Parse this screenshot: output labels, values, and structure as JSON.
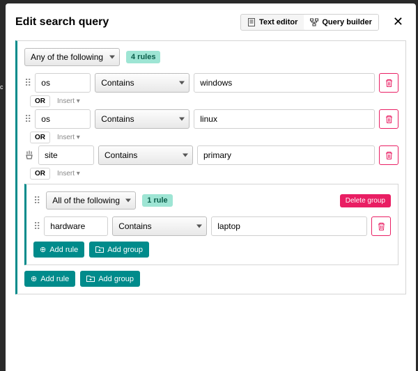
{
  "header": {
    "title": "Edit search query",
    "text_editor": "Text editor",
    "query_builder": "Query builder"
  },
  "group": {
    "mode": "Any of the following",
    "badge": "4 rules",
    "connector": "OR",
    "insert": "Insert ▾",
    "rules": [
      {
        "field": "os",
        "op": "Contains",
        "val": "windows"
      },
      {
        "field": "os",
        "op": "Contains",
        "val": "linux"
      },
      {
        "field": "site",
        "op": "Contains",
        "val": "primary"
      }
    ],
    "nested": {
      "mode": "All of the following",
      "badge": "1 rule",
      "delete": "Delete group",
      "rules": [
        {
          "field": "hardware",
          "op": "Contains",
          "val": "laptop"
        }
      ]
    },
    "add_rule": "Add rule",
    "add_group": "Add group"
  }
}
